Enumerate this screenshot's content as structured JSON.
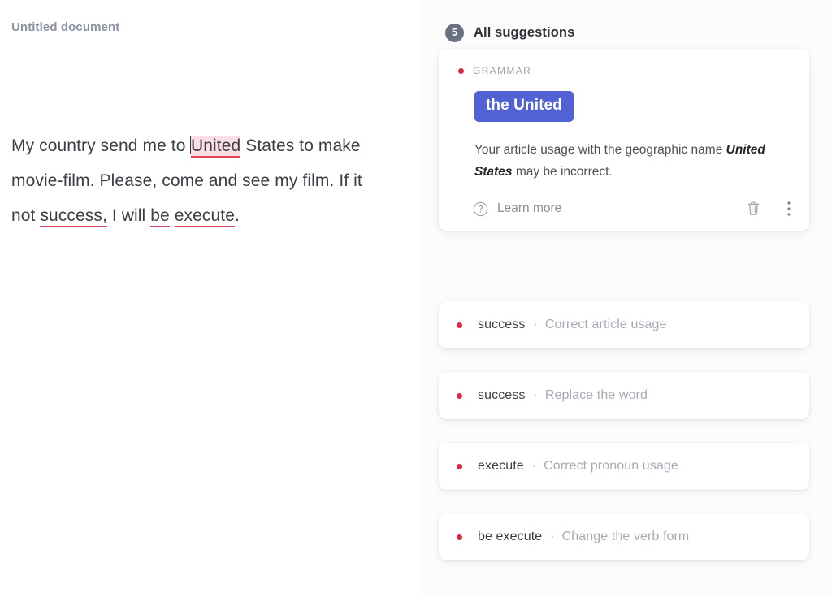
{
  "document": {
    "title": "Untitled document",
    "body_segments": [
      {
        "text": "My country send me to ",
        "style": "plain"
      },
      {
        "text": "United",
        "style": "highlight-error"
      },
      {
        "text": " States to make movie-film. Please, come and see my film. If it not ",
        "style": "plain"
      },
      {
        "text": "success,",
        "style": "underline-error"
      },
      {
        "text": " I will ",
        "style": "plain"
      },
      {
        "text": "be",
        "style": "underline-error"
      },
      {
        "text": " ",
        "style": "plain"
      },
      {
        "text": "execute",
        "style": "underline-error"
      },
      {
        "text": ".",
        "style": "plain"
      }
    ],
    "full_text": "My country send me to United States to make movie-film. Please, come and see my film. If it not success, I will be execute."
  },
  "suggestions_panel": {
    "header": {
      "count": "5",
      "title": "All suggestions"
    },
    "primary_card": {
      "category": "GRAMMAR",
      "replacement": "the United",
      "description_before": "Your article usage with the geographic name ",
      "description_emphasis": "United States",
      "description_after": " may be incorrect.",
      "learn_more_label": "Learn more",
      "help_icon": "question-circle-icon",
      "delete_icon": "trash-icon",
      "more_icon": "more-vertical-icon"
    },
    "items": [
      {
        "target": "success",
        "separator": "·",
        "action": "Correct article usage"
      },
      {
        "target": "success",
        "separator": "·",
        "action": "Replace the word"
      },
      {
        "target": "execute",
        "separator": "·",
        "action": "Correct pronoun usage"
      },
      {
        "target": "be execute",
        "separator": "·",
        "action": "Change the verb form"
      }
    ]
  },
  "colors": {
    "accent_blue": "#5163d4",
    "error_red": "#db2b41",
    "underline_red": "#d94459",
    "highlight_pink": "#fadee4",
    "badge_gray": "#6a7183",
    "text_primary": "#3b3f45",
    "text_muted": "#a7abb6",
    "title_gray": "#8b90a2",
    "page_background": "#fdfdfd",
    "card_background": "#ffffff"
  }
}
